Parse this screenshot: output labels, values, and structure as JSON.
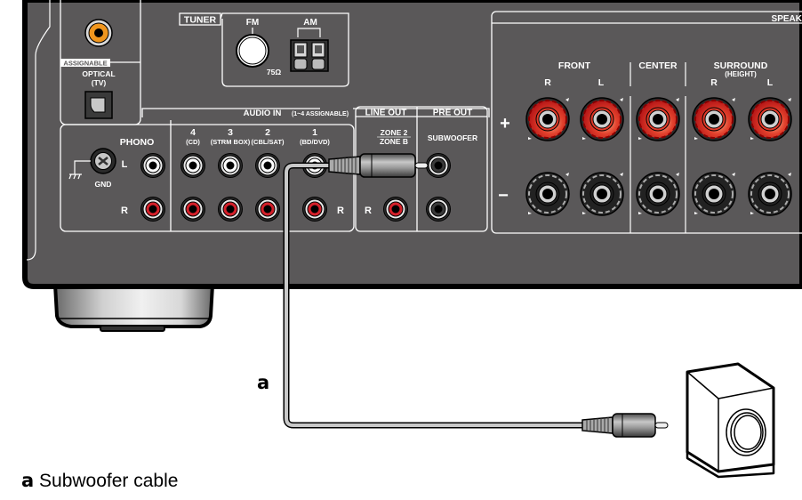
{
  "panel": {
    "tuner": {
      "label": "TUNER",
      "fm_label": "FM",
      "fm_impedance": "75Ω",
      "am_label": "AM"
    },
    "optical": {
      "assignable_tag": "ASSIGNABLE",
      "label": "OPTICAL",
      "sublabel": "(TV)"
    },
    "phono": {
      "label": "PHONO",
      "gnd_label": "GND",
      "left_label": "L",
      "right_label": "R"
    },
    "audio_in": {
      "label": "AUDIO IN",
      "note": "(1~4 ASSIGNABLE)",
      "right_label": "R",
      "inputs": [
        {
          "number": "4",
          "name": "(CD)"
        },
        {
          "number": "3",
          "name": "(STRM BOX)"
        },
        {
          "number": "2",
          "name": "(CBL/SAT)"
        },
        {
          "number": "1",
          "name": "(BD/DVD)"
        }
      ]
    },
    "line_out": {
      "label": "LINE OUT",
      "zone_top": "ZONE 2",
      "zone_bottom": "ZONE B",
      "right_label": "R"
    },
    "pre_out": {
      "label": "PRE OUT",
      "subwoofer_label": "SUBWOOFER"
    },
    "speakers": {
      "label": "SPEAK",
      "plus_sign": "+",
      "minus_sign": "−",
      "groups": [
        {
          "name": "FRONT",
          "sub": "",
          "channels": [
            "R",
            "L"
          ]
        },
        {
          "name": "CENTER",
          "sub": "",
          "channels": []
        },
        {
          "name": "SURROUND",
          "sub": "(HEIGHT)",
          "channels": [
            "R",
            "L"
          ]
        }
      ]
    }
  },
  "callout": {
    "letter": "a"
  },
  "caption": {
    "letter": "a",
    "text": " Subwoofer cable"
  },
  "colors": {
    "panel_fill": "#5a5859",
    "panel_outline": "#000000",
    "label_line": "#ffffff",
    "jack_red": "#d4202a",
    "jack_orange": "#f0961e",
    "foot_light": "#ececec",
    "cable_gray": "#c8c8c8"
  }
}
